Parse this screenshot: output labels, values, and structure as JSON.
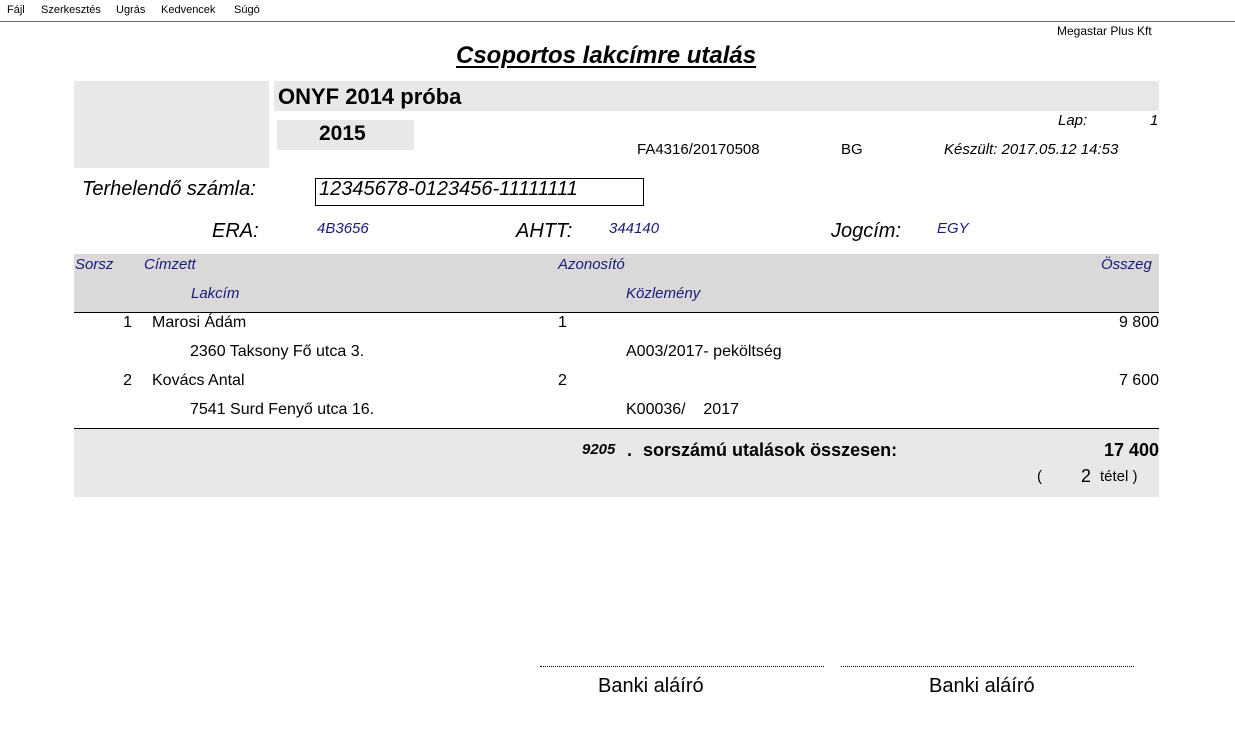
{
  "menu": [
    "Fájl",
    "Szerkesztés",
    "Ugrás",
    "Kedvencek",
    "Súgó"
  ],
  "company": "Megastar Plus Kft",
  "title": "Csoportos lakcímre utalás",
  "org_name": "ONYF 2014 próba",
  "year": "2015",
  "page_label": "Lap:",
  "page_number": "1",
  "file_ref": "FA4316/20170508",
  "code": "BG",
  "created": "Készült: 2017.05.12 14:53",
  "debit_account_label": "Terhelendő számla:",
  "debit_account": "12345678-0123456-11111111",
  "era_label": "ERA:",
  "era_value": "4B3656",
  "ahtt_label": "AHTT:",
  "ahtt_value": "344140",
  "jogcim_label": "Jogcím:",
  "jogcim_value": "EGY",
  "columns": {
    "sorsz": "Sorsz",
    "cimzett": "Címzett",
    "azonosito": "Azonosító",
    "osszeg": "Összeg",
    "lakcim": "Lakcím",
    "kozlemeny": "Közlemény"
  },
  "rows": [
    {
      "no": "1",
      "name": "Marosi Ádám",
      "id": "1",
      "amount": "9 800",
      "address": "2360 Taksony Fő utca 3.",
      "note": "A003/2017- peköltség"
    },
    {
      "no": "2",
      "name": "Kovács Antal",
      "id": "2",
      "amount": "7 600",
      "address": "7541 Surd Fenyő utca 16.",
      "note": "K00036/    2017"
    }
  ],
  "summary": {
    "serial": "9205",
    "dot": ".",
    "text": "sorszámú utalások összesen:",
    "total": "17 400",
    "open_paren": "(",
    "count": "2",
    "tetel": "tétel )"
  },
  "signatures": [
    "Banki aláíró",
    "Banki aláíró"
  ]
}
